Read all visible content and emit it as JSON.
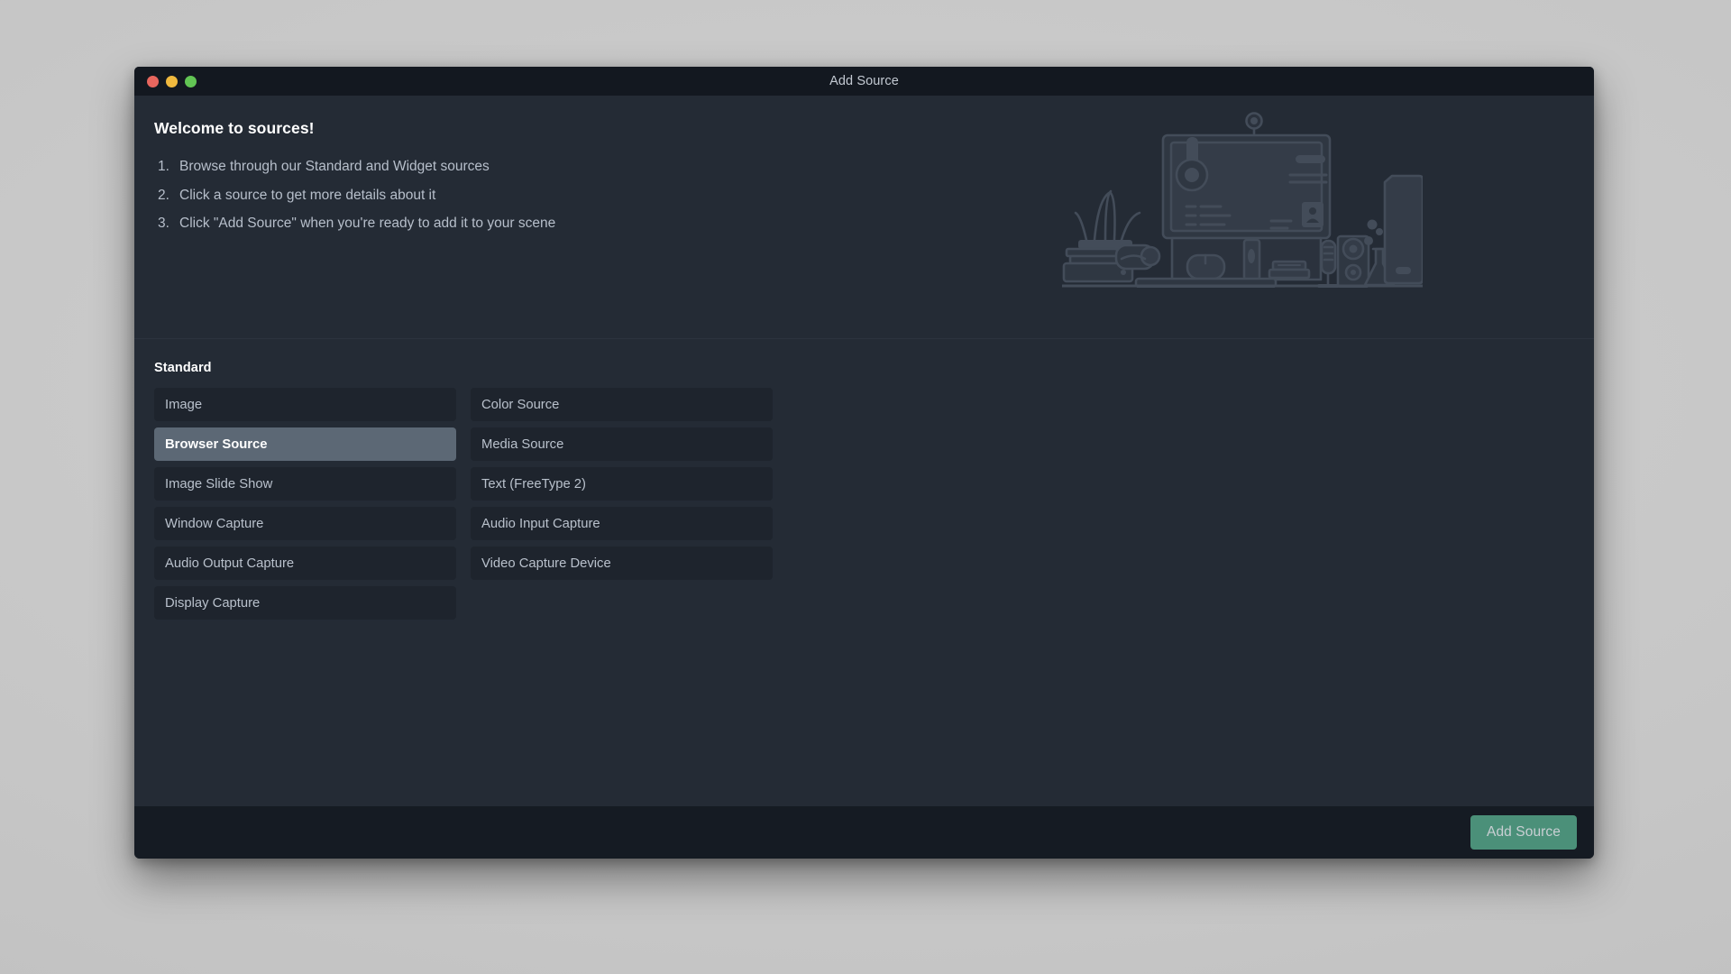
{
  "window": {
    "title": "Add Source",
    "controls": [
      {
        "name": "close",
        "color": "#e8665e"
      },
      {
        "name": "minimize",
        "color": "#f0b93e"
      },
      {
        "name": "maximize",
        "color": "#62c554"
      }
    ]
  },
  "hero": {
    "title": "Welcome to sources!",
    "steps": [
      "Browse through our Standard and Widget sources",
      "Click a source to get more details about it",
      "Click \"Add Source\" when you're ready to add it to your scene"
    ],
    "illustration_name": "desk-workstation-illustration"
  },
  "sources": {
    "group_title": "Standard",
    "selected": "Browser Source",
    "column_left": [
      "Image",
      "Browser Source",
      "Image Slide Show",
      "Window Capture",
      "Audio Output Capture",
      "Display Capture"
    ],
    "column_right": [
      "Color Source",
      "Media Source",
      "Text (FreeType 2)",
      "Audio Input Capture",
      "Video Capture Device"
    ]
  },
  "footer": {
    "add_source_label": "Add Source",
    "add_source_enabled": false
  },
  "colors": {
    "window_bg": "#242b35",
    "titlebar_bg": "#131820",
    "footer_bg": "#151b23",
    "item_bg": "#1e242d",
    "item_selected_bg": "#5c6875",
    "accent_button": "#4b9079",
    "text_primary": "#ffffff",
    "text_secondary": "#b9c1cc",
    "desktop_bg": "#c9c9c9"
  }
}
